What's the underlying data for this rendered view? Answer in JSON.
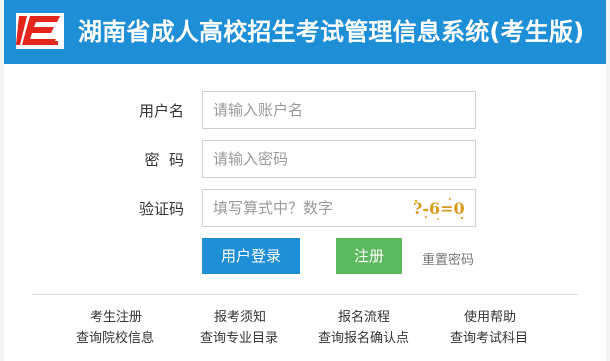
{
  "header": {
    "title": "湖南省成人高校招生考试管理信息系统(考生版)",
    "colors": {
      "header_bg": "#1e8fd6",
      "logo_red": "#e3251c"
    }
  },
  "form": {
    "username": {
      "label": "用户名",
      "placeholder": "请输入账户名"
    },
    "password": {
      "label": "密  码",
      "placeholder": "请输入密码"
    },
    "captcha": {
      "label": "验证码",
      "placeholder": "填写算式中？数字",
      "image_text": "?-6=0"
    }
  },
  "buttons": {
    "login": "用户登录",
    "register": "注册",
    "reset": "重置密码",
    "colors": {
      "login": "#1e8fd6",
      "register": "#5cb85c"
    }
  },
  "links": {
    "row1": [
      "考生注册",
      "报考须知",
      "报名流程",
      "使用帮助"
    ],
    "row2": [
      "查询院校信息",
      "查询专业目录",
      "查询报名确认点",
      "查询考试科目"
    ]
  }
}
